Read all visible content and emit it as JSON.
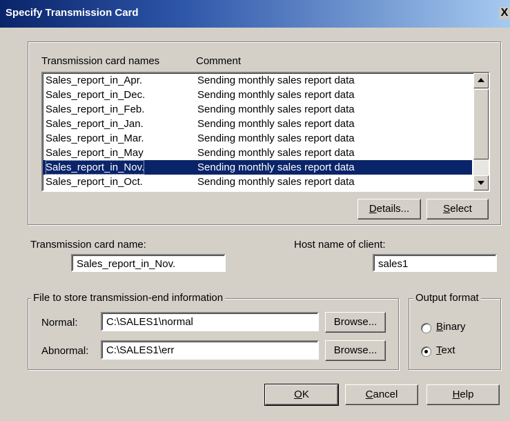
{
  "window": {
    "title": "Specify Transmission Card",
    "close_glyph": "X"
  },
  "list": {
    "columns": [
      "Transmission card names",
      "Comment"
    ],
    "rows": [
      {
        "name": "Sales_report_in_Apr.",
        "comment": "Sending monthly sales report data",
        "selected": false
      },
      {
        "name": "Sales_report_in_Dec.",
        "comment": "Sending monthly sales report data",
        "selected": false
      },
      {
        "name": "Sales_report_in_Feb.",
        "comment": "Sending monthly sales report data",
        "selected": false
      },
      {
        "name": "Sales_report_in_Jan.",
        "comment": "Sending monthly sales report data",
        "selected": false
      },
      {
        "name": "Sales_report_in_Mar.",
        "comment": "Sending monthly sales report data",
        "selected": false
      },
      {
        "name": "Sales_report_in_May",
        "comment": "Sending monthly sales report data",
        "selected": false
      },
      {
        "name": "Sales_report_in_Nov.",
        "comment": "Sending monthly sales report data",
        "selected": true
      },
      {
        "name": "Sales_report_in_Oct.",
        "comment": "Sending monthly sales report data",
        "selected": false
      }
    ],
    "details_button": {
      "pre": "",
      "ul": "D",
      "post": "etails..."
    },
    "select_button": {
      "pre": "",
      "ul": "S",
      "post": "elect"
    }
  },
  "card_name": {
    "label": "Transmission card name:",
    "value": "Sales_report_in_Nov."
  },
  "host": {
    "label": "Host name of client:",
    "value": "sales1"
  },
  "file_group": {
    "legend": "File to store transmission-end information",
    "normal": {
      "label": "Normal:",
      "value": "C:\\SALES1\\normal",
      "browse": "Browse..."
    },
    "abnormal": {
      "label": "Abnormal:",
      "value": "C:\\SALES1\\err",
      "browse": "Browse..."
    }
  },
  "output_format": {
    "legend": "Output format",
    "binary": {
      "pre": "",
      "ul": "B",
      "post": "inary",
      "checked": false
    },
    "text": {
      "pre": "",
      "ul": "T",
      "post": "ext",
      "checked": true
    }
  },
  "footer": {
    "ok": {
      "pre": "",
      "ul": "O",
      "post": "K"
    },
    "cancel": {
      "pre": "",
      "ul": "C",
      "post": "ancel"
    },
    "help": {
      "pre": "",
      "ul": "H",
      "post": "elp"
    }
  }
}
